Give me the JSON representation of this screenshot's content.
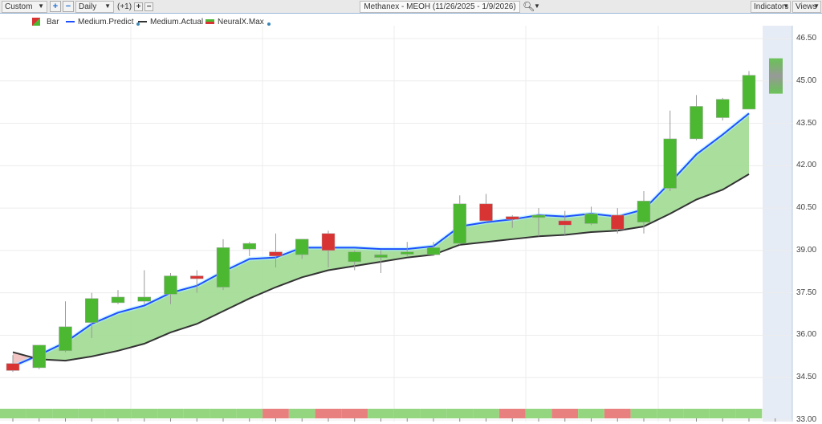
{
  "toolbar": {
    "range_select": "Custom",
    "interval_select": "Daily",
    "offset": "(+1)",
    "title": "Methanex - MEOH (11/26/2025 - 1/9/2026)",
    "indicators_label": "Indicators",
    "views_label": "Views"
  },
  "legend": {
    "items": [
      "Bar",
      "Medium.Predict",
      "Medium.Actual",
      "NeuralX.Max"
    ]
  },
  "colors": {
    "up": "#4cb832",
    "down": "#d93434",
    "predict": "#1e4fff",
    "actual": "#333333",
    "fill": "#a4dc98",
    "strip_green": "#94d67f",
    "strip_red": "#e98080"
  },
  "chart_data": {
    "type": "candlestick",
    "ylim": [
      33.0,
      46.5
    ],
    "yticks": [
      "46.50",
      "45.00",
      "43.50",
      "42.00",
      "40.50",
      "39.00",
      "37.50",
      "36.00",
      "34.50",
      "33.00"
    ],
    "ytick_values": [
      46.5,
      45,
      43.5,
      42,
      40.5,
      39,
      37.5,
      36,
      34.5,
      33
    ],
    "candles": [
      [
        35.0,
        34.75,
        35.3,
        34.7
      ],
      [
        34.85,
        35.65,
        35.65,
        34.8
      ],
      [
        35.45,
        36.3,
        37.2,
        35.4
      ],
      [
        36.45,
        37.3,
        37.5,
        35.9
      ],
      [
        37.15,
        37.35,
        37.6,
        37.1
      ],
      [
        37.2,
        37.35,
        38.3,
        37.1
      ],
      [
        37.45,
        38.1,
        38.2,
        37.1
      ],
      [
        38.1,
        38.0,
        38.3,
        37.5
      ],
      [
        37.7,
        39.1,
        39.4,
        37.6
      ],
      [
        39.05,
        39.25,
        39.3,
        38.8
      ],
      [
        38.95,
        38.8,
        39.6,
        38.4
      ],
      [
        38.85,
        39.4,
        39.4,
        38.7
      ],
      [
        39.6,
        39.0,
        39.7,
        38.4
      ],
      [
        38.6,
        38.95,
        39.0,
        38.3
      ],
      [
        38.75,
        38.85,
        39.0,
        38.2
      ],
      [
        38.9,
        38.95,
        39.3,
        38.8
      ],
      [
        38.85,
        39.1,
        39.3,
        38.8
      ],
      [
        39.25,
        40.65,
        40.95,
        39.2
      ],
      [
        40.65,
        40.05,
        41.0,
        40.0
      ],
      [
        40.2,
        40.1,
        40.25,
        39.8
      ],
      [
        40.25,
        40.25,
        40.5,
        39.5
      ],
      [
        40.05,
        39.9,
        40.4,
        39.55
      ],
      [
        39.95,
        40.3,
        40.55,
        39.9
      ],
      [
        40.25,
        39.75,
        40.5,
        39.6
      ],
      [
        40.0,
        40.75,
        41.1,
        39.6
      ],
      [
        41.2,
        42.95,
        43.95,
        41.1
      ],
      [
        42.95,
        44.1,
        44.5,
        42.9
      ],
      [
        43.7,
        44.35,
        44.4,
        43.6
      ],
      [
        44.0,
        45.2,
        45.35,
        44.0
      ]
    ],
    "forecast": {
      "high": 45.8,
      "low": 44.55
    },
    "series": [
      {
        "name": "Medium.Predict",
        "values": [
          34.9,
          35.3,
          35.75,
          36.4,
          36.8,
          37.05,
          37.5,
          37.75,
          38.25,
          38.7,
          38.75,
          39.1,
          39.1,
          39.1,
          39.05,
          39.05,
          39.15,
          39.85,
          40.0,
          40.1,
          40.25,
          40.2,
          40.3,
          40.2,
          40.45,
          41.4,
          42.4,
          43.1,
          43.85
        ]
      },
      {
        "name": "Medium.Actual",
        "values": [
          35.4,
          35.15,
          35.1,
          35.25,
          35.45,
          35.7,
          36.1,
          36.4,
          36.85,
          37.3,
          37.7,
          38.05,
          38.3,
          38.45,
          38.6,
          38.75,
          38.85,
          39.2,
          39.3,
          39.4,
          39.5,
          39.55,
          39.65,
          39.7,
          39.85,
          40.3,
          40.8,
          41.15,
          41.7
        ]
      }
    ],
    "neuralx_strip": [
      "g",
      "g",
      "g",
      "g",
      "g",
      "g",
      "g",
      "g",
      "g",
      "g",
      "r",
      "g",
      "r",
      "r",
      "g",
      "g",
      "g",
      "g",
      "g",
      "r",
      "g",
      "r",
      "g",
      "r",
      "g",
      "g",
      "g",
      "g",
      "g"
    ]
  }
}
